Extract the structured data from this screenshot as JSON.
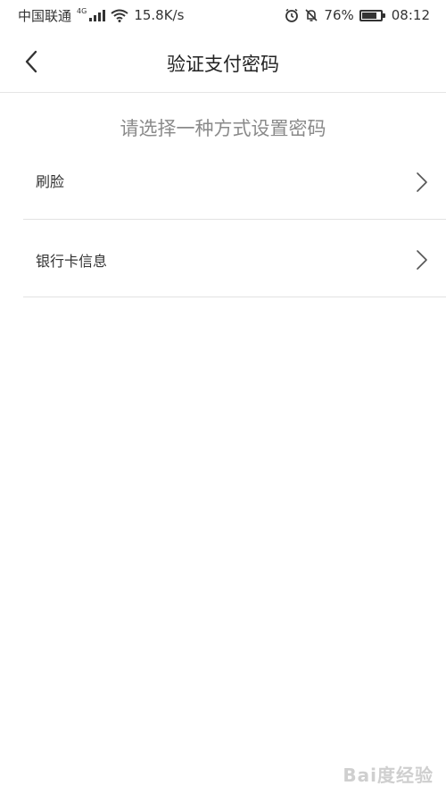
{
  "status_bar": {
    "carrier": "中国联通",
    "network_type": "4G",
    "speed": "15.8K/s",
    "battery": "76%",
    "battery_level": 0.76,
    "time": "08:12"
  },
  "nav": {
    "title": "验证支付密码",
    "back_icon": "chevron-left-icon"
  },
  "subtitle": "请选择一种方式设置密码",
  "options": [
    {
      "label": "刷脸",
      "icon": "chevron-right-icon"
    },
    {
      "label": "银行卡信息",
      "icon": "chevron-right-icon"
    }
  ],
  "watermark": "Bai度经验",
  "colors": {
    "background": "#ffffff",
    "title_text": "#222222",
    "subtitle_text": "#8a8a8a",
    "divider": "#e2e2e2"
  }
}
